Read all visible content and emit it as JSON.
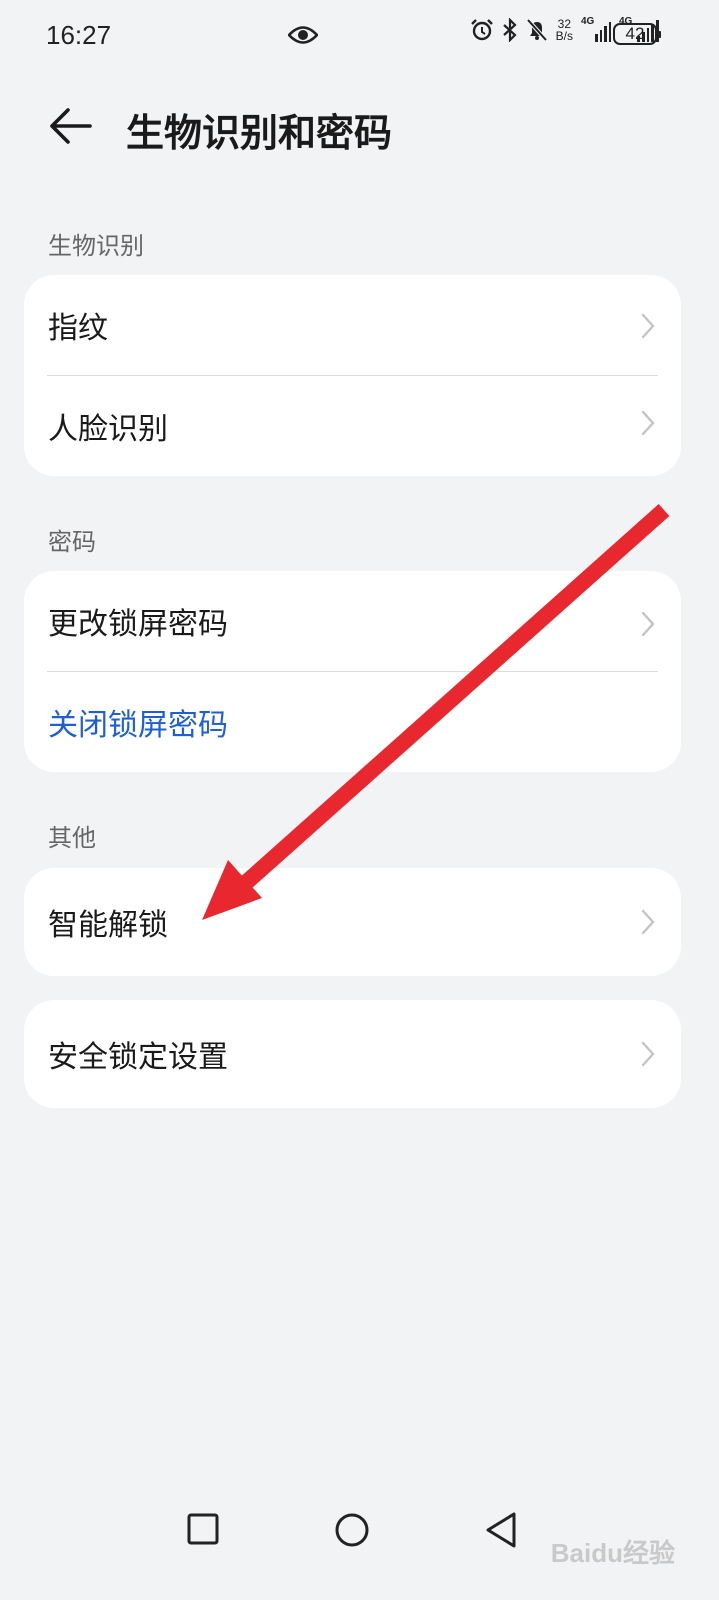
{
  "status_bar": {
    "time": "16:27",
    "net_speed_value": "32",
    "net_speed_unit": "B/s",
    "signal1_label": "4G",
    "signal2_label": "4G",
    "battery": "42",
    "icons": [
      "eye-icon",
      "alarm-icon",
      "bluetooth-icon",
      "mute-bell-icon"
    ]
  },
  "header": {
    "title": "生物识别和密码",
    "back_icon": "back-arrow-icon"
  },
  "sections": [
    {
      "label": "生物识别",
      "items": [
        {
          "label": "指纹"
        },
        {
          "label": "人脸识别"
        }
      ]
    },
    {
      "label": "密码",
      "items": [
        {
          "label": "更改锁屏密码"
        },
        {
          "label": "关闭锁屏密码"
        }
      ]
    },
    {
      "label": "其他",
      "items": [
        {
          "label": "智能解锁"
        }
      ]
    }
  ],
  "standalone_item": {
    "label": "安全锁定设置"
  },
  "colors": {
    "background": "#f1f3f5",
    "link": "#1f5fd6",
    "annotation_arrow": "#e8282e"
  },
  "navbar": {
    "icons": [
      "recent-apps-icon",
      "home-icon",
      "back-icon"
    ]
  },
  "watermark": "Baidu经验"
}
